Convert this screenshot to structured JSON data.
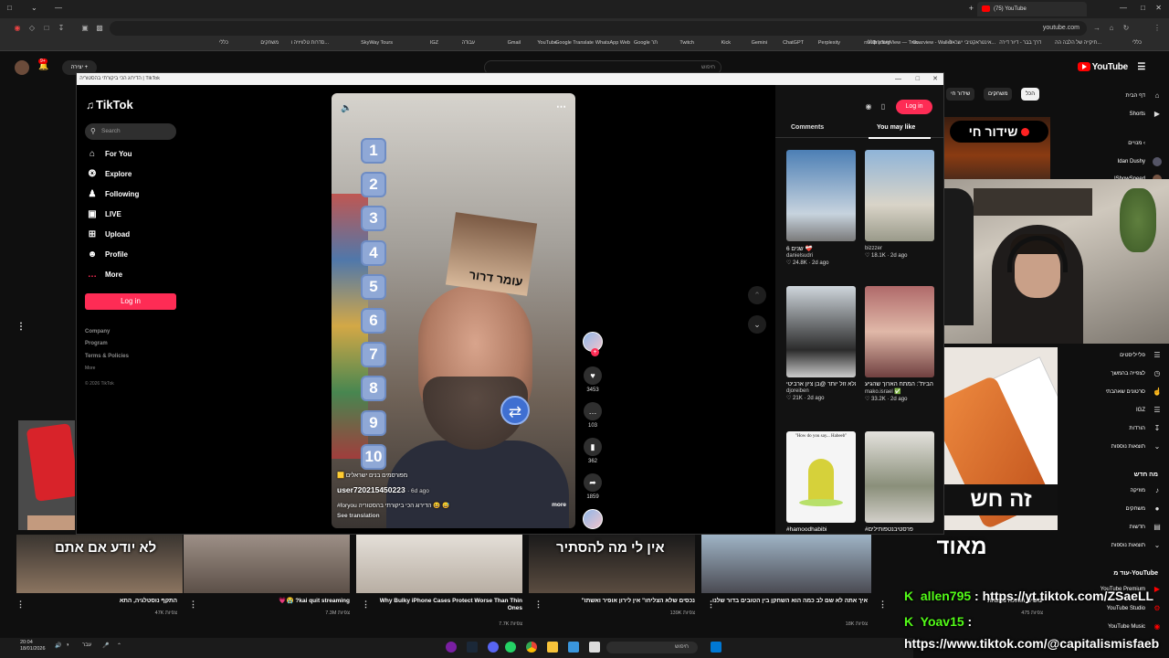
{
  "browser": {
    "tab_title": "(75) YouTube",
    "url": "youtube.com",
    "bookmarks": [
      "כללי",
      "תיקייה של הלבה הה...",
      "דרך בבר - דיור דירה",
      "אינטראקטיבי ישראל...",
      "Overview - Wallet -...",
      "TradingView — Trac...",
      "שעריך כללי",
      "rseup",
      "Perplexity",
      "ChatGPT",
      "Gemini",
      "Kick",
      "Twitch",
      "Google תר",
      "WhatsApp Web",
      "Google Translate",
      "YouTube",
      "Gmail",
      "עבודה",
      "IGZ",
      "SkyWay Tours",
      "סדרות טלוויזיה ו...",
      "משחקים",
      "כללי"
    ]
  },
  "youtube": {
    "logo": "YouTube",
    "search_placeholder": "חיפוש",
    "create_label": "יצירה",
    "notif_count": "9+",
    "chips": [
      "הכל",
      "משחקים",
      "שידור חי"
    ],
    "live_badge": "שידור חי",
    "sidebar": {
      "home": "דף הבית",
      "shorts": "Shorts",
      "subs_head": "מנויים",
      "sub1": "Idan Dushy",
      "sub2": "IShowSpeed",
      "you_items": [
        "פלייליסטים",
        "לצפייה בהמשך",
        "סרטונים שאהבתי",
        "IGZ",
        "הורדות",
        "תוצאות נוספות"
      ],
      "explore_head": "מה חדש",
      "explore_items": [
        "מוזיקה",
        "משחקים",
        "חדשות",
        "תוצאות נוספות"
      ],
      "more_head": "עוד מ-YouTube",
      "more_items": [
        "YouTube Premium",
        "YouTube Studio",
        "YouTube Music"
      ]
    },
    "promo_line1": "זה חש",
    "promo_line2": "מאוד",
    "bottom_videos": [
      {
        "title": "התקף נוסטלגיה, התא",
        "views": "47K צפיות",
        "overlay": "לא יודע אם אתם"
      },
      {
        "title": "💗😭 ?kai quit streaming",
        "views": "7.3M צפיות",
        "overlay": ""
      },
      {
        "title": "Why Bulky iPhone Cases Protect Worse Than Thin Ones",
        "views": "7.7K צפיות",
        "overlay": ""
      },
      {
        "title": "\"נכסים שלא הצליחו\" אין לירון אופיר ואשתו",
        "views": "139K צפיות",
        "overlay": "אין לי מה להסתיר"
      },
      {
        "title": "איך אתה לא שם לב כמה הוא השחקן בין הטובים בדור שלנו",
        "views": "18K צפיות",
        "overlay": ""
      },
      {
        "title": "עושים הותלה מצנחת",
        "views": "475 צפיות",
        "overlay": ""
      }
    ]
  },
  "stream_overlay": {
    "chat": [
      {
        "user": "allen795",
        "msg": ": https://yt.tiktok.com/ZSaeLL"
      },
      {
        "user": "Yoav15",
        "msg": ":"
      }
    ],
    "bottom_url": "https://www.tiktok.com/@capitalismisfaeb"
  },
  "taskbar": {
    "time": "20:04",
    "date": "18/01/2026",
    "search": "חיפוש",
    "lang": "עבר"
  },
  "tiktok": {
    "window_title": "הדירוג הכי ביקורתי בהסטוריה | TikTok",
    "logo": "TikTok",
    "search_placeholder": "Search",
    "nav": [
      "For You",
      "Explore",
      "Following",
      "LIVE",
      "Upload",
      "Profile",
      "More"
    ],
    "login": "Log in",
    "footer": [
      "Company",
      "Program",
      "Terms & Policies",
      "More"
    ],
    "copyright": "© 2026 TikTok",
    "video": {
      "ranks": [
        "1",
        "2",
        "3",
        "4",
        "5",
        "6",
        "7",
        "8",
        "9",
        "10"
      ],
      "poster_text": "עומר דרור",
      "tag": "🟨 מפורסמים בנים ישראלים",
      "user": "user720215450223",
      "ago": "· 6d ago",
      "caption": "#foryou הדירוג הכי ביקורתי בהסטוריה 😆 😅",
      "see_translation": "See translation",
      "more": "more"
    },
    "actions": {
      "likes": "3453",
      "comments": "103",
      "saves": "362",
      "shares": "1859"
    },
    "panel": {
      "tab_comments": "Comments",
      "tab_like": "You may like",
      "login": "Log in",
      "cards": [
        {
          "caption": "6 שנים ❤️‍🩹",
          "author": "danielsudri",
          "stats": "♡ 24.8K · 2d ago"
        },
        {
          "caption": "",
          "author": "bizzzer",
          "stats": "♡ 18.1K · 2d ago"
        },
        {
          "caption": "ממלא זול יותר @בן ציון ארביטי",
          "author": "djoreiben",
          "stats": "♡ 21K · 2d ago"
        },
        {
          "caption": "עדות הבית\": המתח הארוך שהגיע...",
          "author": "mako.israel ✅",
          "stats": "♡ 33.2K · 2d ago"
        },
        {
          "caption": "#hamoodhabibi",
          "author": "",
          "stats": ""
        },
        {
          "caption": "#פרסטיבנטפותילים",
          "author": "",
          "stats": ""
        }
      ],
      "card5_overlay": "\"How do you say... Habeeb\""
    }
  }
}
